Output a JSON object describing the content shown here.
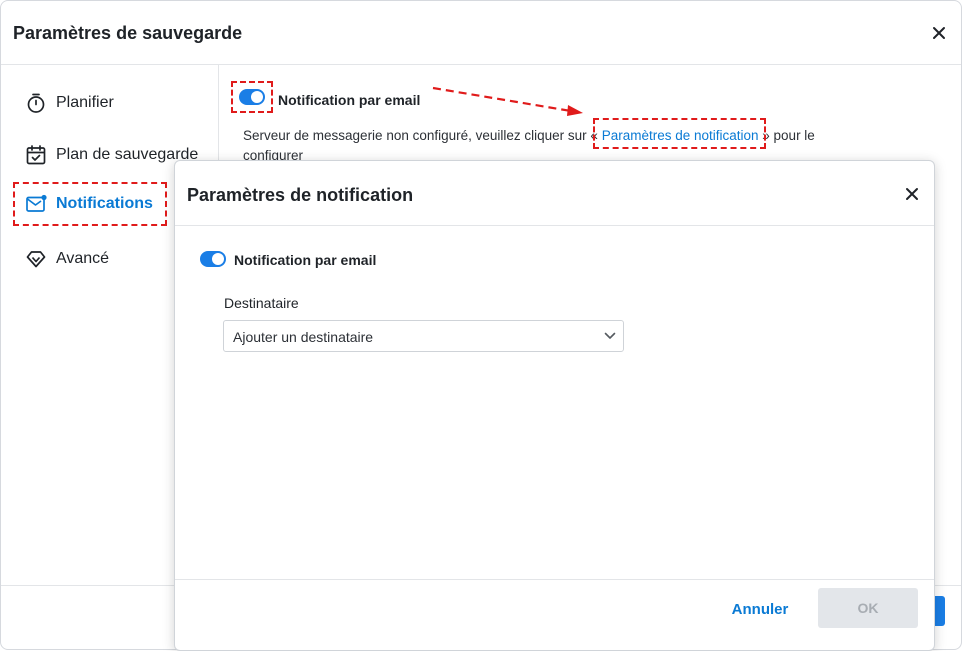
{
  "window": {
    "title": "Paramètres de sauvegarde"
  },
  "sidebar": {
    "items": [
      {
        "label": "Planifier",
        "icon": "timer-icon"
      },
      {
        "label": "Plan de sauvegarde",
        "icon": "calendar-check-icon"
      },
      {
        "label": "Notifications",
        "icon": "mail-notification-icon",
        "active": true
      },
      {
        "label": "Avancé",
        "icon": "diamond-icon"
      }
    ]
  },
  "main": {
    "email_notification_label": "Notification par email",
    "email_notification_enabled": true,
    "description_before": "Serveur de messagerie non configuré, veuillez cliquer sur « ",
    "description_link": "Paramètres de notification",
    "description_after": " » pour le configurer"
  },
  "modal": {
    "title": "Paramètres de notification",
    "email_notification_label": "Notification par email",
    "email_notification_enabled": true,
    "recipient_label": "Destinataire",
    "recipient_placeholder": "Ajouter un destinataire",
    "cancel_label": "Annuler",
    "ok_label": "OK"
  },
  "colors": {
    "accent": "#1a7ee6",
    "link": "#0a7ad4",
    "annotation": "#e01b1b",
    "disabled_button_bg": "#e3e6ea"
  }
}
